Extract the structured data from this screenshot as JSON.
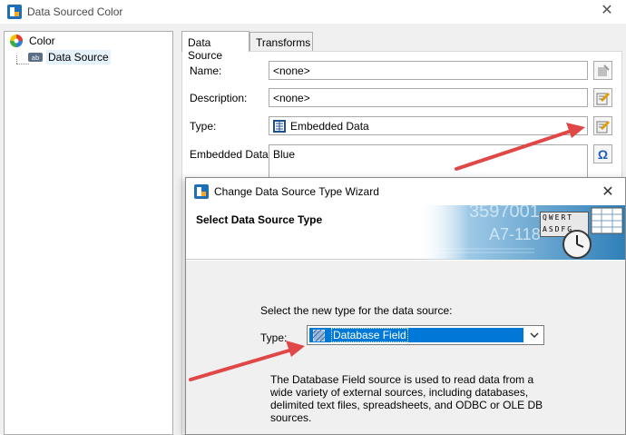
{
  "window": {
    "title": "Data Sourced Color",
    "close_glyph": "✕"
  },
  "tree": {
    "items": [
      {
        "label": "Color",
        "icon": "color-wheel-icon"
      },
      {
        "label": "Data Source",
        "icon": "text-data-icon"
      }
    ]
  },
  "tabs": [
    {
      "label": "Data Source",
      "active": true
    },
    {
      "label": "Transforms",
      "active": false
    }
  ],
  "form": {
    "name_label": "Name:",
    "name_value": "<none>",
    "description_label": "Description:",
    "description_value": "<none>",
    "type_label": "Type:",
    "type_value": "Embedded Data",
    "embedded_label": "Embedded Data:",
    "embedded_value": "Blue",
    "omega_glyph": "Ω"
  },
  "wizard": {
    "title": "Change Data Source Type Wizard",
    "close_glyph": "✕",
    "heading": "Select Data Source Type",
    "banner_text_1": "3597001",
    "banner_text_2": "A7-118",
    "banner_keys_row1": "QWERT",
    "banner_keys_row2": "ASDFG",
    "instruction": "Select the new type for the data source:",
    "type_label": "Type:",
    "type_selected": "Database Field",
    "description": "The Database Field source is used to read data from a wide variety of external sources, including databases, delimited text files, spreadsheets, and ODBC or OLE DB sources."
  },
  "colors": {
    "accent": "#0078d7",
    "annotation_arrow": "#e04848",
    "banner_blue": "#3a8fc1"
  }
}
